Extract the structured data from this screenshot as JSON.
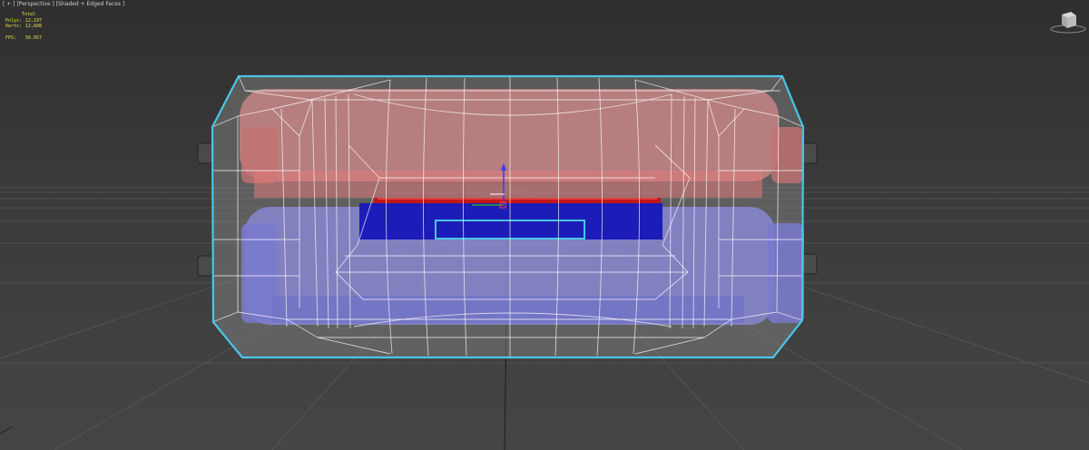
{
  "viewport": {
    "label_parts": [
      "[ + ]",
      "[Perspective ]",
      "[Shaded + Edged Faces ]"
    ],
    "stats": {
      "header": "Total",
      "polys_label": "Polys:",
      "polys_value": "12,197",
      "verts_label": "Verts:",
      "verts_value": "12,608",
      "fps_label": "FPS:",
      "fps_value": "56.057"
    }
  },
  "scene": {
    "background_color": "#3a3a3a",
    "grid_color": "#5a5a5a",
    "selection_color": "#49c6e8",
    "top_body_color": "#d98e8e",
    "bottom_body_color": "#8e8edc",
    "inner_blue_color": "#1a1ab5",
    "red_strip_color": "#b51a1a",
    "wire_color": "#ffffff"
  },
  "icons": {
    "viewcube": "viewcube-icon",
    "gizmo": "transform-gizmo-icon"
  }
}
